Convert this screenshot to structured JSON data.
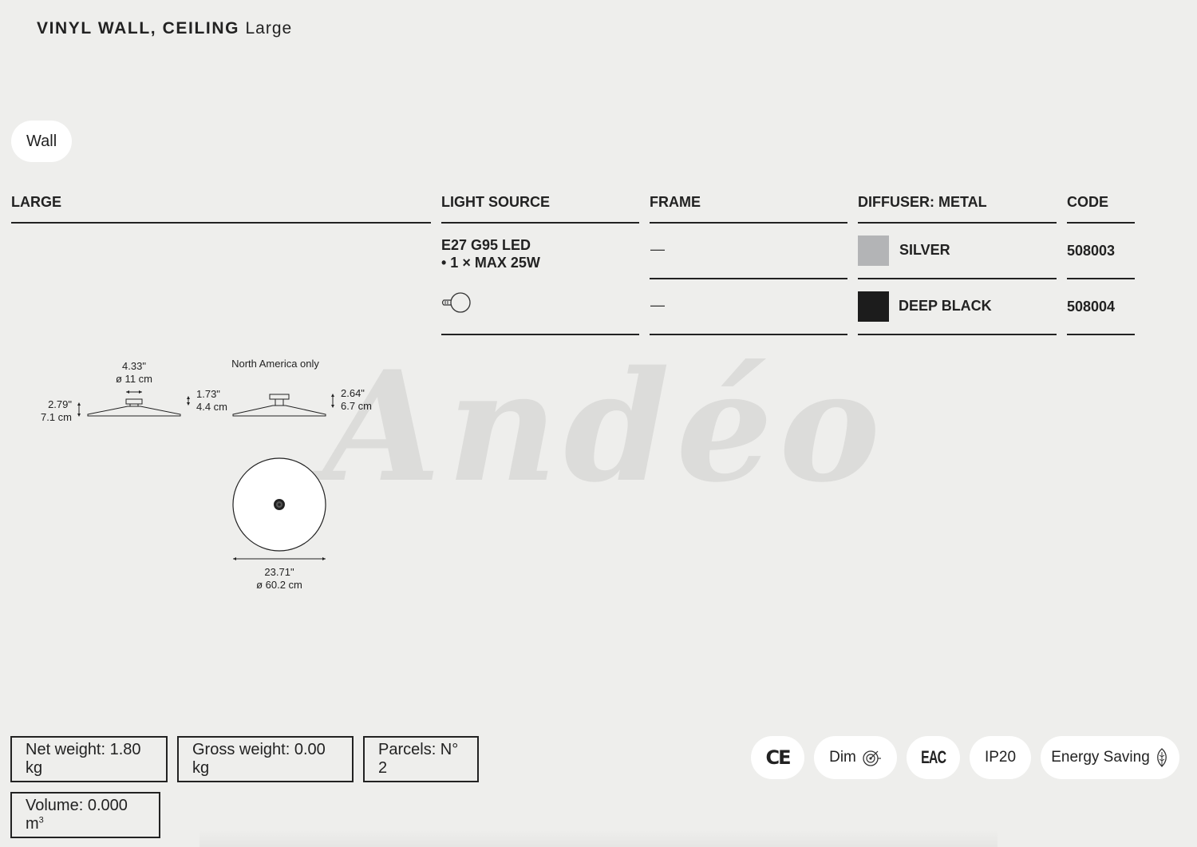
{
  "header": {
    "title_main": "VINYL WALL, CEILING",
    "title_size": "Large"
  },
  "mount_pill": "Wall",
  "table": {
    "headers": {
      "model": "LARGE",
      "light_source": "LIGHT SOURCE",
      "frame": "FRAME",
      "diffuser": "DIFFUSER: METAL",
      "code": "CODE"
    },
    "light_source_line1": "E27 G95 LED",
    "light_source_line2": "• 1 × MAX 25W",
    "rows": [
      {
        "frame": "—",
        "diffuser": "SILVER",
        "swatch_color": "#b3b4b6",
        "code": "508003"
      },
      {
        "frame": "—",
        "diffuser": "DEEP BLACK",
        "swatch_color": "#1c1c1c",
        "code": "508004"
      }
    ]
  },
  "drawing": {
    "canopy_in": "4.33\"",
    "canopy_cm": "ø 11 cm",
    "height_in": "2.79\"",
    "height_cm": "7.1 cm",
    "canopy_h_in": "1.73\"",
    "canopy_h_cm": "4.4 cm",
    "na_label": "North America only",
    "na_h_in": "2.64\"",
    "na_h_cm": "6.7 cm",
    "dia_in": "23.71\"",
    "dia_cm": "ø 60.2 cm"
  },
  "watermark": "Andéo",
  "specs": {
    "net_weight": "Net weight: 1.80 kg",
    "gross_weight": "Gross weight: 0.00 kg",
    "parcels": "Parcels: N° 2",
    "volume": "Volume: 0.000 m",
    "volume_sup": "3"
  },
  "badges": {
    "ce": "CE",
    "dim": "Dim",
    "eac": "EAC",
    "ip": "IP20",
    "energy": "Energy Saving"
  }
}
